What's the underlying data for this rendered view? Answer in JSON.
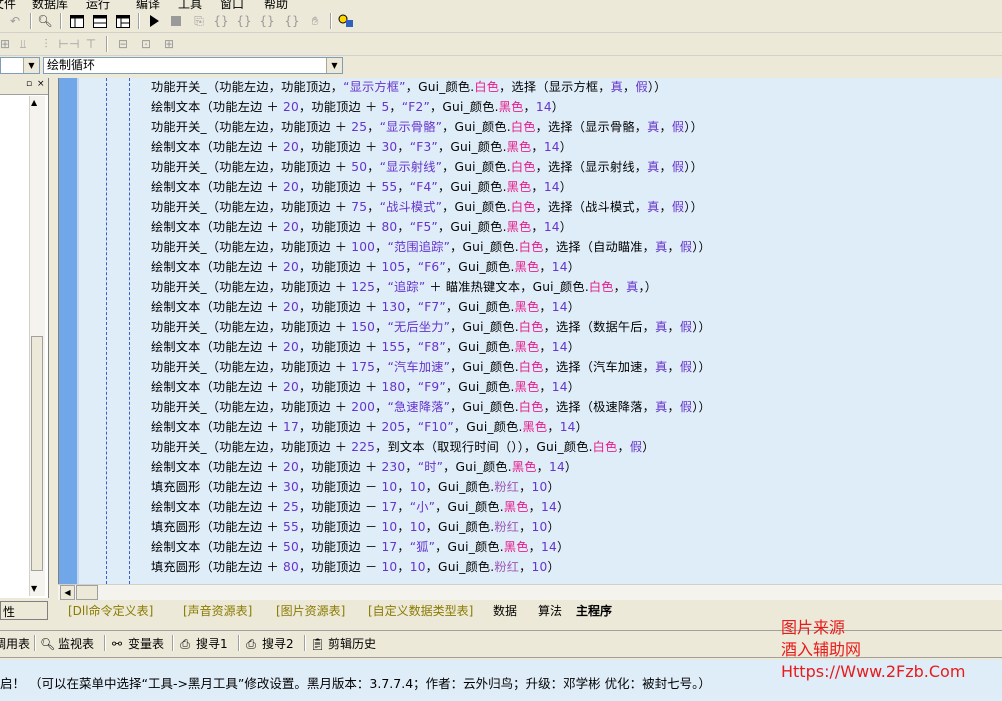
{
  "menu": [
    "文件",
    "数据库",
    "运行",
    "编译",
    "工具",
    "窗口",
    "帮助"
  ],
  "toolbar_row1": {
    "icons": [
      "undo-icon",
      "find-icon",
      "layout1-icon",
      "layout2-icon",
      "layout3-icon",
      "run-icon",
      "stop-icon",
      "step-icon",
      "step-into-icon",
      "step-over-icon",
      "step-out-icon",
      "hand-icon",
      "tool-icon"
    ]
  },
  "toolbar_row2": {
    "icons": [
      "align-left-icon",
      "align-top-icon",
      "align-right-icon",
      "distribute-h-icon",
      "distribute-v-icon",
      "same-width-icon",
      "same-height-icon",
      "same-size-icon"
    ]
  },
  "combos": {
    "left": "",
    "right": "绘制循环"
  },
  "left_panel": {
    "bottom_label": "性"
  },
  "code": {
    "lines": [
      [
        [
          "功能开关_（功能左边，功能顶边，",
          ""
        ],
        [
          "“显示方框”",
          "s"
        ],
        [
          "，Gui_颜色.",
          ""
        ],
        [
          "白色",
          "w"
        ],
        [
          "，选择（显示方框，",
          ""
        ],
        [
          "真",
          "n"
        ],
        [
          "，",
          ""
        ],
        [
          "假",
          "n"
        ],
        [
          "））",
          ""
        ]
      ],
      [
        [
          "绘制文本（功能左边 ＋ ",
          ""
        ],
        [
          "20",
          "n"
        ],
        [
          "，功能顶边 ＋ ",
          ""
        ],
        [
          "5",
          "n"
        ],
        [
          "，",
          ""
        ],
        [
          "“F2”",
          "s"
        ],
        [
          "，Gui_颜色.",
          ""
        ],
        [
          "黑色",
          "b"
        ],
        [
          "，",
          ""
        ],
        [
          "14",
          "n"
        ],
        [
          "）",
          ""
        ]
      ],
      [
        [
          "功能开关_（功能左边，功能顶边 ＋ ",
          ""
        ],
        [
          "25",
          "n"
        ],
        [
          "，",
          ""
        ],
        [
          "“显示骨骼”",
          "s"
        ],
        [
          "，Gui_颜色.",
          ""
        ],
        [
          "白色",
          "w"
        ],
        [
          "，选择（显示骨骼，",
          ""
        ],
        [
          "真",
          "n"
        ],
        [
          "，",
          ""
        ],
        [
          "假",
          "n"
        ],
        [
          "））",
          ""
        ]
      ],
      [
        [
          "绘制文本（功能左边 ＋ ",
          ""
        ],
        [
          "20",
          "n"
        ],
        [
          "，功能顶边 ＋ ",
          ""
        ],
        [
          "30",
          "n"
        ],
        [
          "，",
          ""
        ],
        [
          "“F3”",
          "s"
        ],
        [
          "，Gui_颜色.",
          ""
        ],
        [
          "黑色",
          "b"
        ],
        [
          "，",
          ""
        ],
        [
          "14",
          "n"
        ],
        [
          "）",
          ""
        ]
      ],
      [
        [
          "功能开关_（功能左边，功能顶边 ＋ ",
          ""
        ],
        [
          "50",
          "n"
        ],
        [
          "，",
          ""
        ],
        [
          "“显示射线”",
          "s"
        ],
        [
          "，Gui_颜色.",
          ""
        ],
        [
          "白色",
          "w"
        ],
        [
          "，选择（显示射线，",
          ""
        ],
        [
          "真",
          "n"
        ],
        [
          "，",
          ""
        ],
        [
          "假",
          "n"
        ],
        [
          "））",
          ""
        ]
      ],
      [
        [
          "绘制文本（功能左边 ＋ ",
          ""
        ],
        [
          "20",
          "n"
        ],
        [
          "，功能顶边 ＋ ",
          ""
        ],
        [
          "55",
          "n"
        ],
        [
          "，",
          ""
        ],
        [
          "“F4”",
          "s"
        ],
        [
          "，Gui_颜色.",
          ""
        ],
        [
          "黑色",
          "b"
        ],
        [
          "，",
          ""
        ],
        [
          "14",
          "n"
        ],
        [
          "）",
          ""
        ]
      ],
      [
        [
          "功能开关_（功能左边，功能顶边 ＋ ",
          ""
        ],
        [
          "75",
          "n"
        ],
        [
          "，",
          ""
        ],
        [
          "“战斗模式”",
          "s"
        ],
        [
          "，Gui_颜色.",
          ""
        ],
        [
          "白色",
          "w"
        ],
        [
          "，选择（战斗模式，",
          ""
        ],
        [
          "真",
          "n"
        ],
        [
          "，",
          ""
        ],
        [
          "假",
          "n"
        ],
        [
          "））",
          ""
        ]
      ],
      [
        [
          "绘制文本（功能左边 ＋ ",
          ""
        ],
        [
          "20",
          "n"
        ],
        [
          "，功能顶边 ＋ ",
          ""
        ],
        [
          "80",
          "n"
        ],
        [
          "，",
          ""
        ],
        [
          "“F5”",
          "s"
        ],
        [
          "，Gui_颜色.",
          ""
        ],
        [
          "黑色",
          "b"
        ],
        [
          "，",
          ""
        ],
        [
          "14",
          "n"
        ],
        [
          "）",
          ""
        ]
      ],
      [
        [
          "功能开关_（功能左边，功能顶边 ＋ ",
          ""
        ],
        [
          "100",
          "n"
        ],
        [
          "，",
          ""
        ],
        [
          "“范围追踪”",
          "s"
        ],
        [
          "，Gui_颜色.",
          ""
        ],
        [
          "白色",
          "w"
        ],
        [
          "，选择（自动瞄准，",
          ""
        ],
        [
          "真",
          "n"
        ],
        [
          "，",
          ""
        ],
        [
          "假",
          "n"
        ],
        [
          "））",
          ""
        ]
      ],
      [
        [
          "绘制文本（功能左边 ＋ ",
          ""
        ],
        [
          "20",
          "n"
        ],
        [
          "，功能顶边 ＋ ",
          ""
        ],
        [
          "105",
          "n"
        ],
        [
          "，",
          ""
        ],
        [
          "“F6”",
          "s"
        ],
        [
          "，Gui_颜色.",
          ""
        ],
        [
          "黑色",
          "b"
        ],
        [
          "，",
          ""
        ],
        [
          "14",
          "n"
        ],
        [
          "）",
          ""
        ]
      ],
      [
        [
          "功能开关_（功能左边，功能顶边 ＋ ",
          ""
        ],
        [
          "125",
          "n"
        ],
        [
          "，",
          ""
        ],
        [
          "“追踪”",
          "s"
        ],
        [
          " ＋ 瞄准热键文本，Gui_颜色.",
          ""
        ],
        [
          "白色",
          "w"
        ],
        [
          "，",
          ""
        ],
        [
          "真",
          "n"
        ],
        [
          "，）",
          ""
        ]
      ],
      [
        [
          "绘制文本（功能左边 ＋ ",
          ""
        ],
        [
          "20",
          "n"
        ],
        [
          "，功能顶边 ＋ ",
          ""
        ],
        [
          "130",
          "n"
        ],
        [
          "，",
          ""
        ],
        [
          "“F7”",
          "s"
        ],
        [
          "，Gui_颜色.",
          ""
        ],
        [
          "黑色",
          "b"
        ],
        [
          "，",
          ""
        ],
        [
          "14",
          "n"
        ],
        [
          "）",
          ""
        ]
      ],
      [
        [
          "功能开关_（功能左边，功能顶边 ＋ ",
          ""
        ],
        [
          "150",
          "n"
        ],
        [
          "，",
          ""
        ],
        [
          "“无后坐力”",
          "s"
        ],
        [
          "，Gui_颜色.",
          ""
        ],
        [
          "白色",
          "w"
        ],
        [
          "，选择（数据午后，",
          ""
        ],
        [
          "真",
          "n"
        ],
        [
          "，",
          ""
        ],
        [
          "假",
          "n"
        ],
        [
          "））",
          ""
        ]
      ],
      [
        [
          "绘制文本（功能左边 ＋ ",
          ""
        ],
        [
          "20",
          "n"
        ],
        [
          "，功能顶边 ＋ ",
          ""
        ],
        [
          "155",
          "n"
        ],
        [
          "，",
          ""
        ],
        [
          "“F8”",
          "s"
        ],
        [
          "，Gui_颜色.",
          ""
        ],
        [
          "黑色",
          "b"
        ],
        [
          "，",
          ""
        ],
        [
          "14",
          "n"
        ],
        [
          "）",
          ""
        ]
      ],
      [
        [
          "功能开关_（功能左边，功能顶边 ＋ ",
          ""
        ],
        [
          "175",
          "n"
        ],
        [
          "，",
          ""
        ],
        [
          "“汽车加速”",
          "s"
        ],
        [
          "，Gui_颜色.",
          ""
        ],
        [
          "白色",
          "w"
        ],
        [
          "，选择（汽车加速，",
          ""
        ],
        [
          "真",
          "n"
        ],
        [
          "，",
          ""
        ],
        [
          "假",
          "n"
        ],
        [
          "））",
          ""
        ]
      ],
      [
        [
          "绘制文本（功能左边 ＋ ",
          ""
        ],
        [
          "20",
          "n"
        ],
        [
          "，功能顶边 ＋ ",
          ""
        ],
        [
          "180",
          "n"
        ],
        [
          "，",
          ""
        ],
        [
          "“F9”",
          "s"
        ],
        [
          "，Gui_颜色.",
          ""
        ],
        [
          "黑色",
          "b"
        ],
        [
          "，",
          ""
        ],
        [
          "14",
          "n"
        ],
        [
          "）",
          ""
        ]
      ],
      [
        [
          "功能开关_（功能左边，功能顶边 ＋ ",
          ""
        ],
        [
          "200",
          "n"
        ],
        [
          "，",
          ""
        ],
        [
          "“急速降落”",
          "s"
        ],
        [
          "，Gui_颜色.",
          ""
        ],
        [
          "白色",
          "w"
        ],
        [
          "，选择（极速降落，",
          ""
        ],
        [
          "真",
          "n"
        ],
        [
          "，",
          ""
        ],
        [
          "假",
          "n"
        ],
        [
          "））",
          ""
        ]
      ],
      [
        [
          "绘制文本（功能左边 ＋ ",
          ""
        ],
        [
          "17",
          "n"
        ],
        [
          "，功能顶边 ＋ ",
          ""
        ],
        [
          "205",
          "n"
        ],
        [
          "，",
          ""
        ],
        [
          "“F10”",
          "s"
        ],
        [
          "，Gui_颜色.",
          ""
        ],
        [
          "黑色",
          "b"
        ],
        [
          "，",
          ""
        ],
        [
          "14",
          "n"
        ],
        [
          "）",
          ""
        ]
      ],
      [
        [
          "功能开关_（功能左边，功能顶边 ＋ ",
          ""
        ],
        [
          "225",
          "n"
        ],
        [
          "，到文本（取现行时间（）），Gui_颜色.",
          ""
        ],
        [
          "白色",
          "w"
        ],
        [
          "，",
          ""
        ],
        [
          "假",
          "n"
        ],
        [
          "）",
          ""
        ]
      ],
      [
        [
          "绘制文本（功能左边 ＋ ",
          ""
        ],
        [
          "20",
          "n"
        ],
        [
          "，功能顶边 ＋ ",
          ""
        ],
        [
          "230",
          "n"
        ],
        [
          "，",
          ""
        ],
        [
          "“时”",
          "s"
        ],
        [
          "，Gui_颜色.",
          ""
        ],
        [
          "黑色",
          "b"
        ],
        [
          "，",
          ""
        ],
        [
          "14",
          "n"
        ],
        [
          "）",
          ""
        ]
      ],
      [
        [
          "填充圆形（功能左边 ＋ ",
          ""
        ],
        [
          "30",
          "n"
        ],
        [
          "，功能顶边 － ",
          ""
        ],
        [
          "10",
          "n"
        ],
        [
          "，",
          ""
        ],
        [
          "10",
          "n"
        ],
        [
          "，Gui_颜色.",
          ""
        ],
        [
          "粉红",
          "p"
        ],
        [
          "，",
          ""
        ],
        [
          "10",
          "n"
        ],
        [
          "）",
          ""
        ]
      ],
      [
        [
          "绘制文本（功能左边 ＋ ",
          ""
        ],
        [
          "25",
          "n"
        ],
        [
          "，功能顶边 － ",
          ""
        ],
        [
          "17",
          "n"
        ],
        [
          "，",
          ""
        ],
        [
          "“小”",
          "s"
        ],
        [
          "，Gui_颜色.",
          ""
        ],
        [
          "黑色",
          "b"
        ],
        [
          "，",
          ""
        ],
        [
          "14",
          "n"
        ],
        [
          "）",
          ""
        ]
      ],
      [
        [
          "填充圆形（功能左边 ＋ ",
          ""
        ],
        [
          "55",
          "n"
        ],
        [
          "，功能顶边 － ",
          ""
        ],
        [
          "10",
          "n"
        ],
        [
          "，",
          ""
        ],
        [
          "10",
          "n"
        ],
        [
          "，Gui_颜色.",
          ""
        ],
        [
          "粉红",
          "p"
        ],
        [
          "，",
          ""
        ],
        [
          "10",
          "n"
        ],
        [
          "）",
          ""
        ]
      ],
      [
        [
          "绘制文本（功能左边 ＋ ",
          ""
        ],
        [
          "50",
          "n"
        ],
        [
          "，功能顶边 － ",
          ""
        ],
        [
          "17",
          "n"
        ],
        [
          "，",
          ""
        ],
        [
          "“狐”",
          "s"
        ],
        [
          "，Gui_颜色.",
          ""
        ],
        [
          "黑色",
          "b"
        ],
        [
          "，",
          ""
        ],
        [
          "14",
          "n"
        ],
        [
          "）",
          ""
        ]
      ],
      [
        [
          "填充圆形（功能左边 ＋ ",
          ""
        ],
        [
          "80",
          "n"
        ],
        [
          "，功能顶边 － ",
          ""
        ],
        [
          "10",
          "n"
        ],
        [
          "，",
          ""
        ],
        [
          "10",
          "n"
        ],
        [
          "，Gui_颜色.",
          ""
        ],
        [
          "粉红",
          "p"
        ],
        [
          "，",
          ""
        ],
        [
          "10",
          "n"
        ],
        [
          "）",
          ""
        ]
      ]
    ]
  },
  "tabs": [
    {
      "label": "[Dll命令定义表]",
      "style": "yellow"
    },
    {
      "label": "[声音资源表]",
      "style": "yellow"
    },
    {
      "label": "[图片资源表]",
      "style": "yellow"
    },
    {
      "label": "[自定义数据类型表]",
      "style": "yellow"
    },
    {
      "label": "数据",
      "style": "normal"
    },
    {
      "label": "算法",
      "style": "normal"
    },
    {
      "label": "主程序",
      "style": "active"
    }
  ],
  "bottom_tabs": [
    {
      "label": "调用表",
      "icon": ""
    },
    {
      "label": "监视表",
      "icon": "magnifier-icon"
    },
    {
      "label": "变量表",
      "icon": "variables-icon"
    },
    {
      "label": "搜寻1",
      "icon": "search1-icon"
    },
    {
      "label": "搜寻2",
      "icon": "search2-icon"
    },
    {
      "label": "剪辑历史",
      "icon": "clipboard-icon"
    }
  ],
  "status": {
    "text": "启！ （可以在菜单中选择“工具->黑月工具”修改设置。黑月版本：3.7.7.4；作者：云外归鸟；升级：邓学彬 优化：被封七号。）"
  },
  "watermark": {
    "line1": "图片来源",
    "line2": "酒入辅助网",
    "line3": "Https://Www.2Fzb.Com"
  },
  "colors": {
    "editor_bg": "#dfedf9",
    "gutter": "#6fa7e8",
    "string": "#6633cc",
    "color_name": "#e81b8a",
    "watermark": "#e81b1b"
  }
}
